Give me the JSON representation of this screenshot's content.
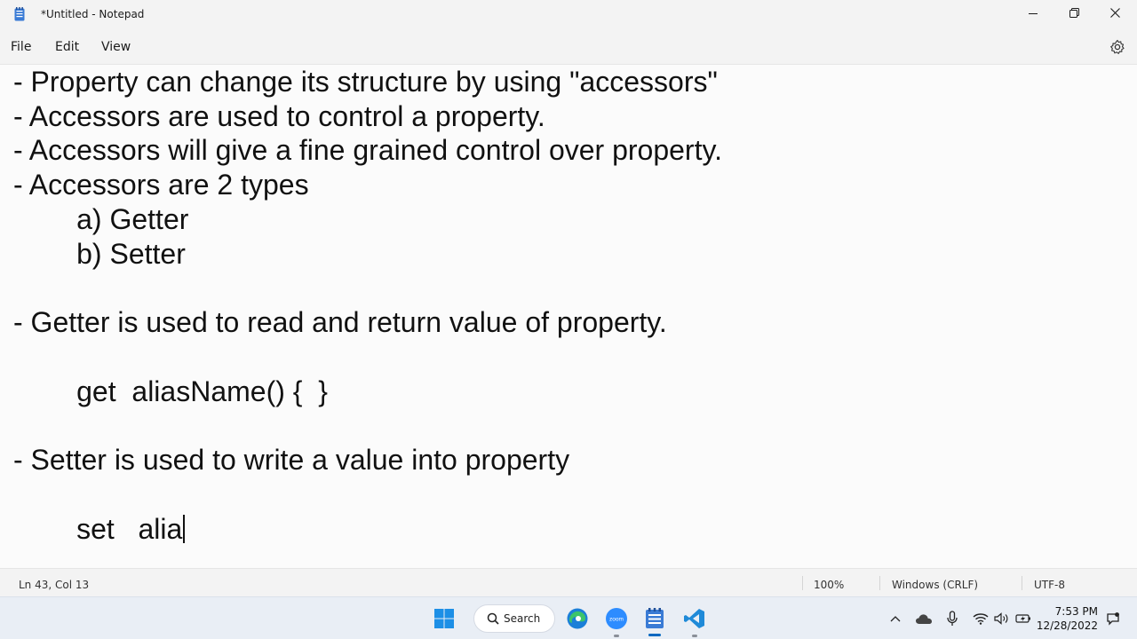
{
  "window": {
    "title": "*Untitled - Notepad",
    "minimize_icon": "minimize-icon",
    "restore_icon": "restore-icon",
    "close_icon": "close-icon"
  },
  "menu": {
    "items": [
      "File",
      "Edit",
      "View"
    ],
    "settings_icon": "gear-icon"
  },
  "editor": {
    "lines": [
      "- Property can change its structure by using \"accessors\"",
      "- Accessors are used to control a property.",
      "- Accessors will give a fine grained control over property.",
      "- Accessors are 2 types",
      "        a) Getter",
      "        b) Setter",
      "",
      "- Getter is used to read and return value of property.",
      "",
      "        get  aliasName() {  }",
      "",
      "- Setter is used to write a value into property",
      "",
      "        set   alia"
    ]
  },
  "status": {
    "position": "Ln 43, Col 13",
    "zoom": "100%",
    "line_ending": "Windows (CRLF)",
    "encoding": "UTF-8"
  },
  "taskbar": {
    "search_label": "Search",
    "apps": [
      "windows-start",
      "search",
      "edge",
      "zoom",
      "notepad",
      "vscode"
    ],
    "zoom_label": "zoom",
    "time": "7:53 PM",
    "date": "12/28/2022"
  },
  "colors": {
    "accent": "#0067c0",
    "editor_bg": "#fbfbfb",
    "chrome_bg": "#f3f3f3"
  }
}
